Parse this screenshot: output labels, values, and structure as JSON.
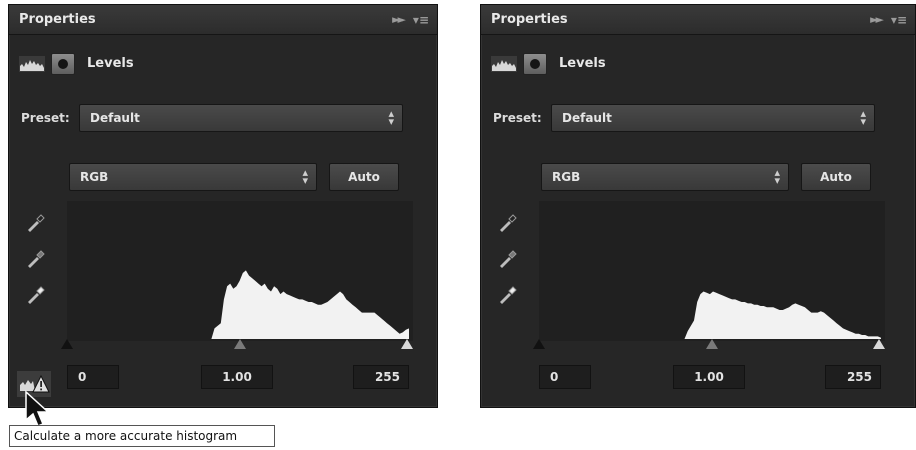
{
  "panels": [
    {
      "title": "Properties",
      "adjustment": "Levels",
      "preset_label": "Preset:",
      "preset_value": "Default",
      "channel": "RGB",
      "auto_label": "Auto",
      "input_black": "0",
      "input_gamma": "1.00",
      "input_white": "255",
      "histogram": [
        0,
        0,
        0,
        0,
        0,
        0,
        0,
        0,
        0,
        0,
        0,
        0,
        0,
        0,
        0,
        0,
        0,
        0,
        0,
        0,
        0,
        0,
        0,
        0,
        0,
        0,
        0,
        0,
        0,
        0,
        0,
        0,
        0,
        0,
        0,
        0,
        0.08,
        0.1,
        0.12,
        0.3,
        0.4,
        0.42,
        0.38,
        0.4,
        0.44,
        0.5,
        0.52,
        0.48,
        0.46,
        0.44,
        0.42,
        0.4,
        0.42,
        0.38,
        0.36,
        0.4,
        0.38,
        0.34,
        0.36,
        0.34,
        0.33,
        0.32,
        0.31,
        0.3,
        0.3,
        0.29,
        0.28,
        0.28,
        0.27,
        0.26,
        0.26,
        0.27,
        0.28,
        0.3,
        0.32,
        0.34,
        0.36,
        0.34,
        0.3,
        0.28,
        0.26,
        0.24,
        0.22,
        0.2,
        0.2,
        0.2,
        0.2,
        0.2,
        0.18,
        0.16,
        0.14,
        0.12,
        0.1,
        0.08,
        0.06,
        0.04,
        0.05,
        0.07,
        0.08
      ],
      "collapsed_warning": true
    },
    {
      "title": "Properties",
      "adjustment": "Levels",
      "preset_label": "Preset:",
      "preset_value": "Default",
      "channel": "RGB",
      "auto_label": "Auto",
      "input_black": "0",
      "input_gamma": "1.00",
      "input_white": "255",
      "histogram": [
        0,
        0,
        0,
        0,
        0,
        0,
        0,
        0,
        0,
        0,
        0,
        0,
        0,
        0,
        0,
        0,
        0,
        0,
        0,
        0,
        0,
        0,
        0,
        0,
        0,
        0,
        0,
        0,
        0,
        0,
        0,
        0,
        0,
        0,
        0,
        0,
        0.06,
        0.1,
        0.14,
        0.28,
        0.34,
        0.36,
        0.35,
        0.34,
        0.36,
        0.35,
        0.34,
        0.33,
        0.32,
        0.31,
        0.3,
        0.3,
        0.29,
        0.28,
        0.28,
        0.27,
        0.27,
        0.26,
        0.26,
        0.25,
        0.25,
        0.24,
        0.24,
        0.24,
        0.23,
        0.22,
        0.22,
        0.23,
        0.24,
        0.26,
        0.27,
        0.26,
        0.25,
        0.24,
        0.22,
        0.2,
        0.2,
        0.2,
        0.21,
        0.2,
        0.18,
        0.16,
        0.14,
        0.12,
        0.1,
        0.08,
        0.07,
        0.06,
        0.05,
        0.04,
        0.04,
        0.03,
        0.03,
        0.02,
        0.02,
        0.02,
        0.02,
        0.01
      ],
      "collapsed_warning": false
    }
  ],
  "tooltip": "Calculate a more accurate histogram",
  "colors": {
    "panel_bg": "#262626",
    "histogram_fill": "#f2f2f2"
  }
}
